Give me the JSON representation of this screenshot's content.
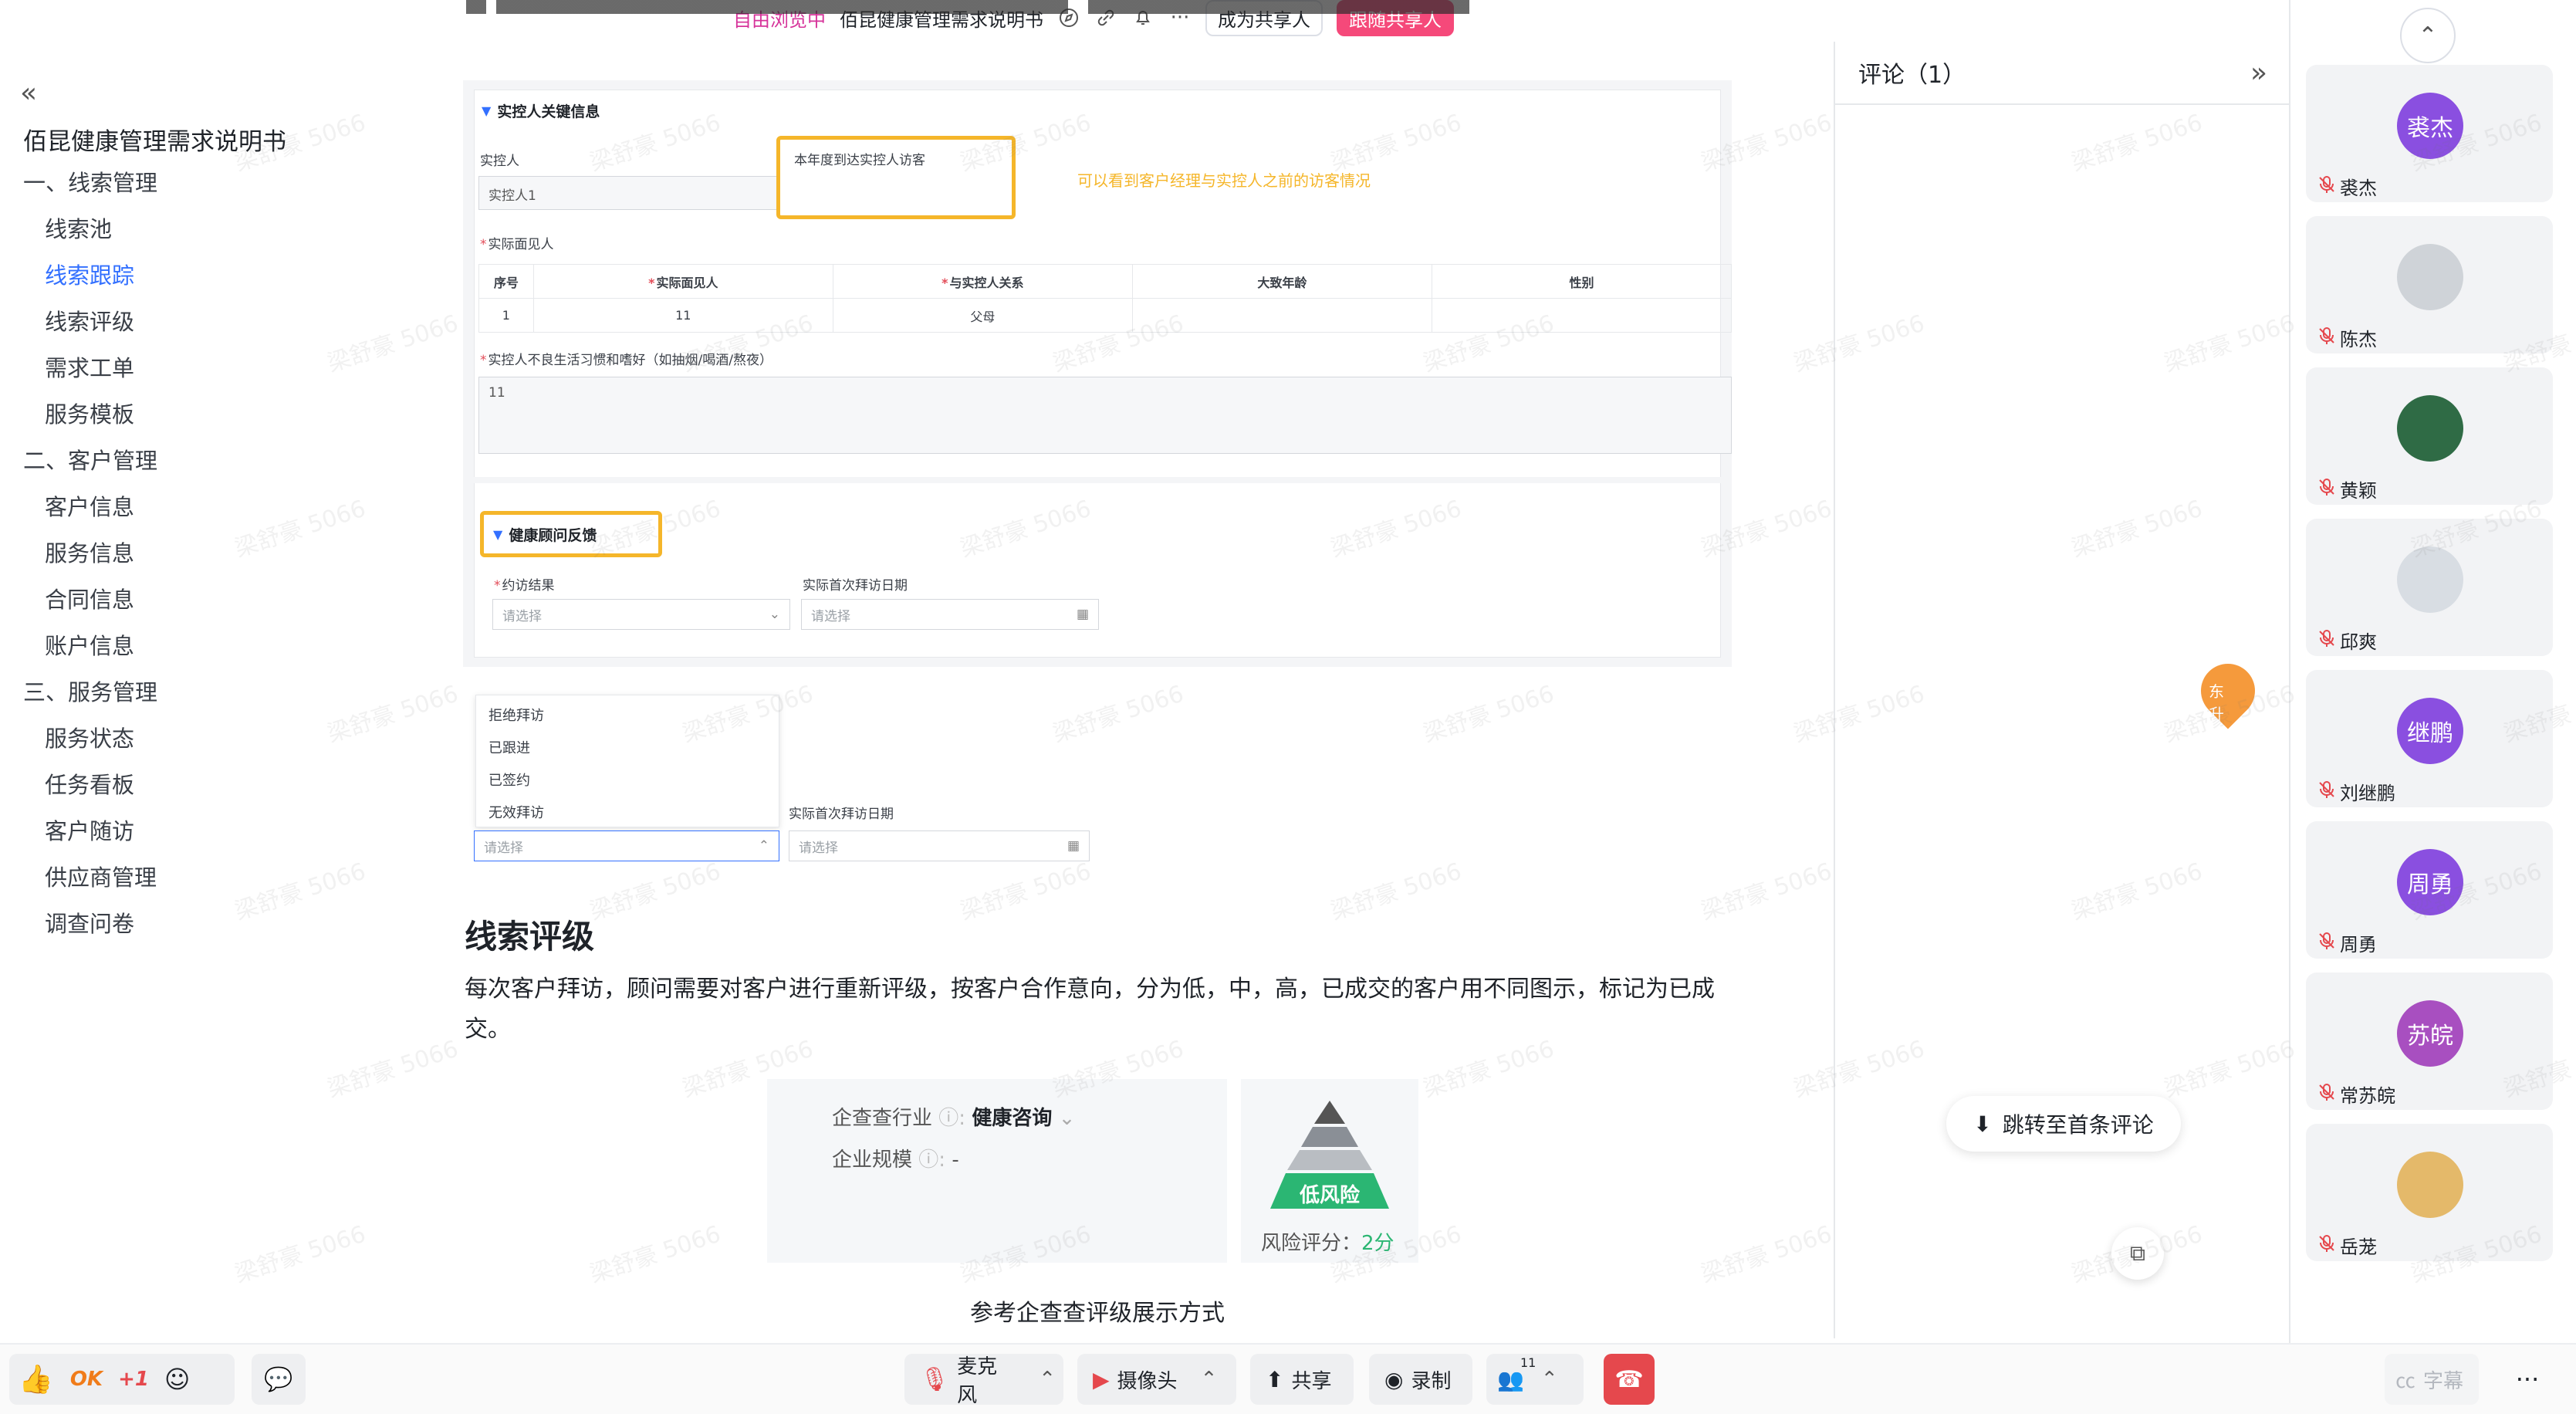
{
  "topbar": {
    "mode_label": "自由浏览中",
    "doc_title": "佰昆健康管理需求说明书",
    "become_sharer": "成为共享人",
    "follow_sharer": "跟随共享人"
  },
  "toc": {
    "title": "佰昆健康管理需求说明书",
    "items": [
      {
        "label": "一、线索管理",
        "level": "section"
      },
      {
        "label": "线索池",
        "level": "sub"
      },
      {
        "label": "线索跟踪",
        "level": "sub",
        "active": true
      },
      {
        "label": "线索评级",
        "level": "sub"
      },
      {
        "label": "需求工单",
        "level": "sub"
      },
      {
        "label": "服务模板",
        "level": "sub"
      },
      {
        "label": "二、客户管理",
        "level": "section"
      },
      {
        "label": "客户信息",
        "level": "sub"
      },
      {
        "label": "服务信息",
        "level": "sub"
      },
      {
        "label": "合同信息",
        "level": "sub"
      },
      {
        "label": "账户信息",
        "level": "sub"
      },
      {
        "label": "三、服务管理",
        "level": "section"
      },
      {
        "label": "服务状态",
        "level": "sub"
      },
      {
        "label": "任务看板",
        "level": "sub"
      },
      {
        "label": "客户随访",
        "level": "sub"
      },
      {
        "label": "供应商管理",
        "level": "sub"
      },
      {
        "label": "调查问卷",
        "level": "sub"
      }
    ]
  },
  "doc": {
    "section1_title": "实控人关键信息",
    "controller_label": "实控人",
    "controller_value": "实控人1",
    "visit_box_label": "本年度到达实控人访客",
    "annotation": "可以看到客户经理与实控人之前的访客情况",
    "met_person_label": "实际面见人",
    "table_headers": [
      "序号",
      "实际面见人",
      "与实控人关系",
      "大致年龄",
      "性别"
    ],
    "table_rows": [
      [
        "1",
        "11",
        "父母",
        "",
        ""
      ]
    ],
    "habits_label": "实控人不良生活习惯和嗜好（如抽烟/喝酒/熬夜）",
    "habits_value": "11",
    "section2_title": "健康顾问反馈",
    "visit_result_label": "约访结果",
    "visit_date_label": "实际首次拜访日期",
    "select_placeholder": "请选择",
    "dropdown_options": [
      "拒绝拜访",
      "已跟进",
      "已签约",
      "无效拜访"
    ],
    "heading": "线索评级",
    "paragraph": "每次客户拜访，顾问需要对客户进行重新评级，按客户合作意向，分为低，中，高，已成交的客户用不同图示，标记为已成交。",
    "industry_label": "企查查行业",
    "industry_value": "健康咨询",
    "scale_label": "企业规模",
    "scale_value": "-",
    "risk_label": "低风险",
    "risk_score_label": "风险评分：",
    "risk_score_value": "2分",
    "caption": "参考企查查评级展示方式",
    "cursor_user": "东升",
    "watermark": "梁舒豪 5066"
  },
  "comments": {
    "title": "评论（1）",
    "jump_label": "跳转至首条评论"
  },
  "participants": [
    {
      "name": "裘杰",
      "avatar_text": "裘杰",
      "color": "#8a4fe0"
    },
    {
      "name": "陈杰",
      "avatar_text": "",
      "color": "#cfd3d8"
    },
    {
      "name": "黄颖",
      "avatar_text": "",
      "color": "#2f6b45"
    },
    {
      "name": "邱爽",
      "avatar_text": "",
      "color": "#d8dde3"
    },
    {
      "name": "刘继鹏",
      "avatar_text": "继鹏",
      "color": "#8a4fe0"
    },
    {
      "name": "周勇",
      "avatar_text": "周勇",
      "color": "#8a4fe0"
    },
    {
      "name": "常苏皖",
      "avatar_text": "苏皖",
      "color": "#a84fc0"
    },
    {
      "name": "岳茏",
      "avatar_text": "",
      "color": "#e4b96a"
    }
  ],
  "bottombar": {
    "reactions": [
      "OK",
      "+1"
    ],
    "mic_label": "麦克风",
    "camera_label": "摄像头",
    "share_label": "共享",
    "record_label": "录制",
    "participants_count": "11",
    "subtitle_label": "字幕"
  },
  "colors": {
    "accent": "#3370ff",
    "highlight": "#f5b62a",
    "danger": "#e34d59",
    "avatar_purple": "#8a4fe0",
    "risk_green": "#2bb673",
    "hangup": "#e5484d"
  }
}
